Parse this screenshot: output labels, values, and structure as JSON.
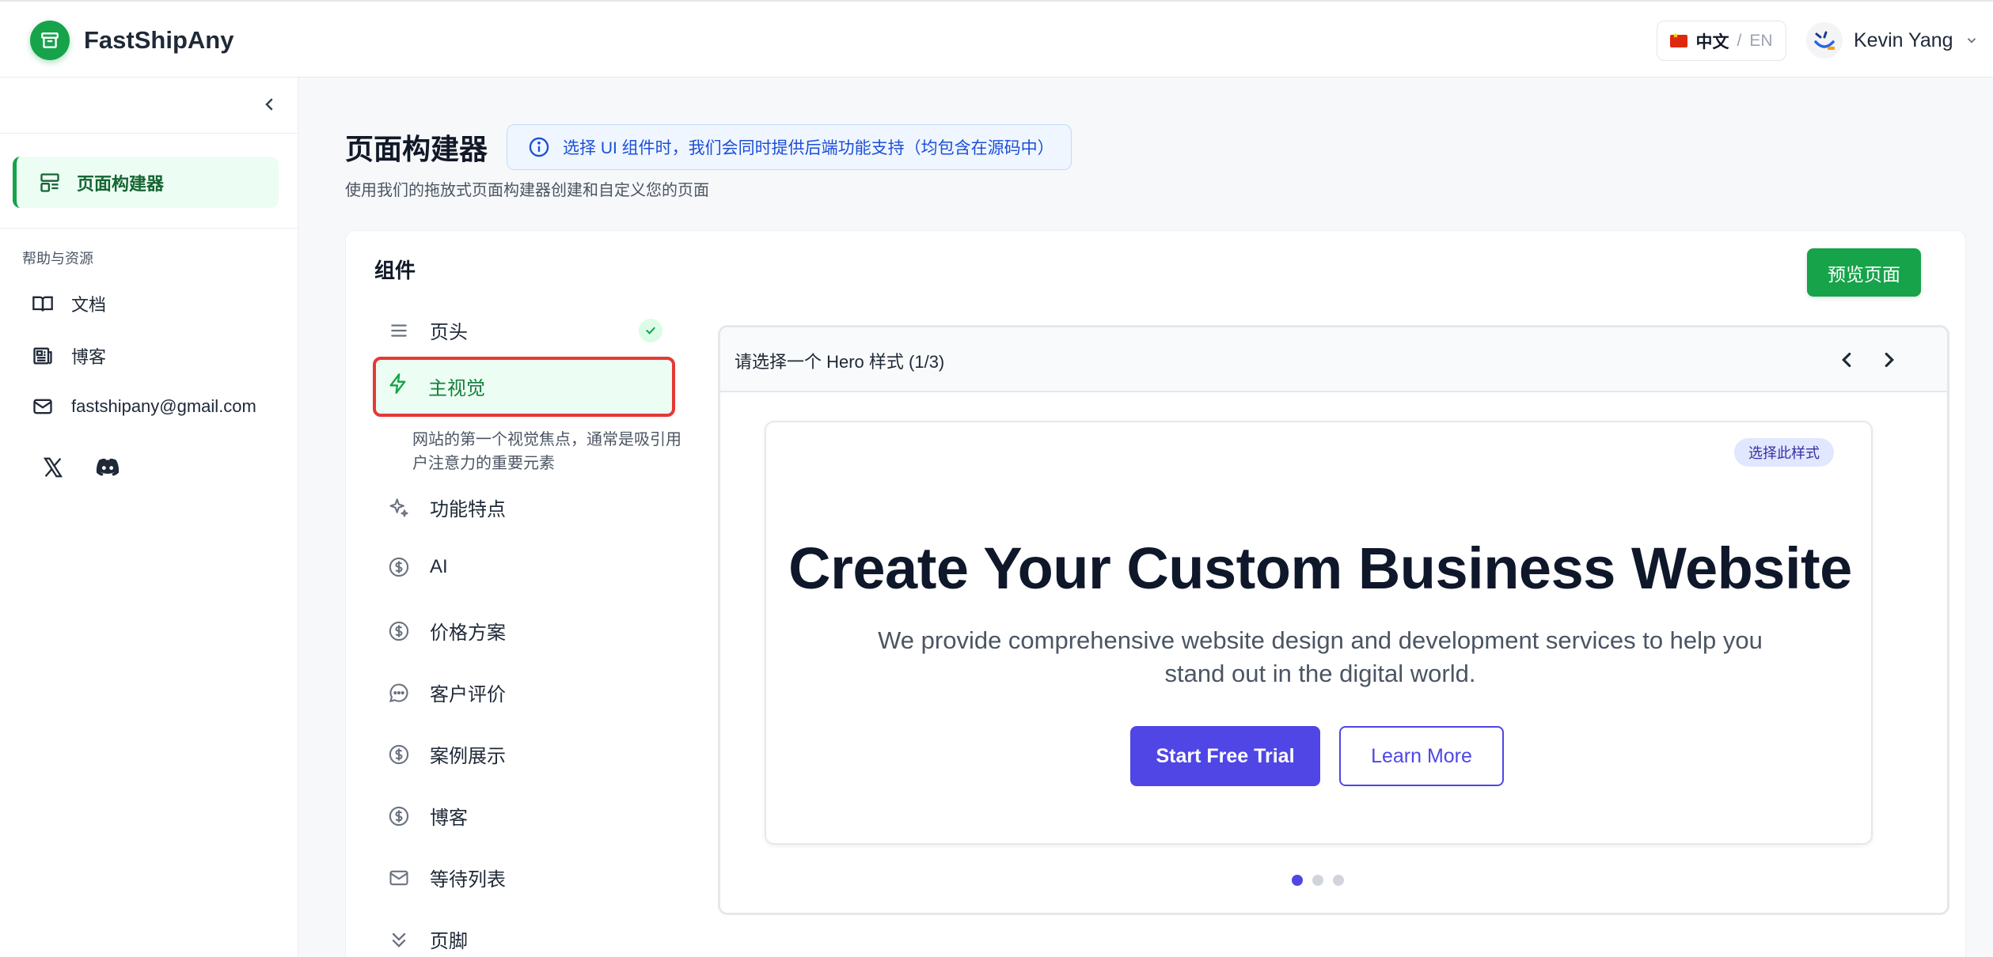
{
  "header": {
    "app_name": "FastShipAny",
    "lang": {
      "current": "中文",
      "separator": "/",
      "alt": "EN"
    },
    "user_name": "Kevin Yang"
  },
  "sidebar": {
    "active_item": "页面构建器",
    "section_title": "帮助与资源",
    "links": [
      {
        "label": "文档",
        "icon": "book-icon"
      },
      {
        "label": "博客",
        "icon": "newspaper-icon"
      },
      {
        "label": "fastshipany@gmail.com",
        "icon": "mail-icon"
      }
    ],
    "socials": [
      "x-icon",
      "discord-icon"
    ]
  },
  "page": {
    "title": "页面构建器",
    "info": "选择 UI 组件时，我们会同时提供后端功能支持（均包含在源码中）",
    "subtitle": "使用我们的拖放式页面构建器创建和自定义您的页面"
  },
  "components": {
    "title": "组件",
    "preview_button": "预览页面",
    "items": [
      {
        "label": "页头",
        "icon": "menu-icon"
      },
      {
        "label": "主视觉",
        "icon": "lightning-icon"
      },
      {
        "label": "功能特点",
        "icon": "sparkles-icon"
      },
      {
        "label": "AI",
        "icon": "dollar-circle-icon"
      },
      {
        "label": "价格方案",
        "icon": "dollar-circle-icon"
      },
      {
        "label": "客户评价",
        "icon": "chat-bubble-icon"
      },
      {
        "label": "案例展示",
        "icon": "dollar-circle-icon"
      },
      {
        "label": "博客",
        "icon": "dollar-circle-icon"
      },
      {
        "label": "等待列表",
        "icon": "mail-icon"
      },
      {
        "label": "页脚",
        "icon": "chevrons-down-icon"
      }
    ],
    "selected_description": "网站的第一个视觉焦点，通常是吸引用户注意力的重要元素"
  },
  "viewer": {
    "label": "请选择一个 Hero 样式 (1/3)",
    "select_badge": "选择此样式",
    "hero_title": "Create Your Custom Business Website",
    "hero_subtitle": "We provide comprehensive website design and development services to help you stand out in the digital world.",
    "primary_cta": "Start Free Trial",
    "secondary_cta": "Learn More",
    "current_slide": 1,
    "total_slides": 3
  },
  "colors": {
    "brand_green": "#16a34a",
    "accent_indigo": "#4f46e5",
    "highlight_red": "#e53935"
  }
}
